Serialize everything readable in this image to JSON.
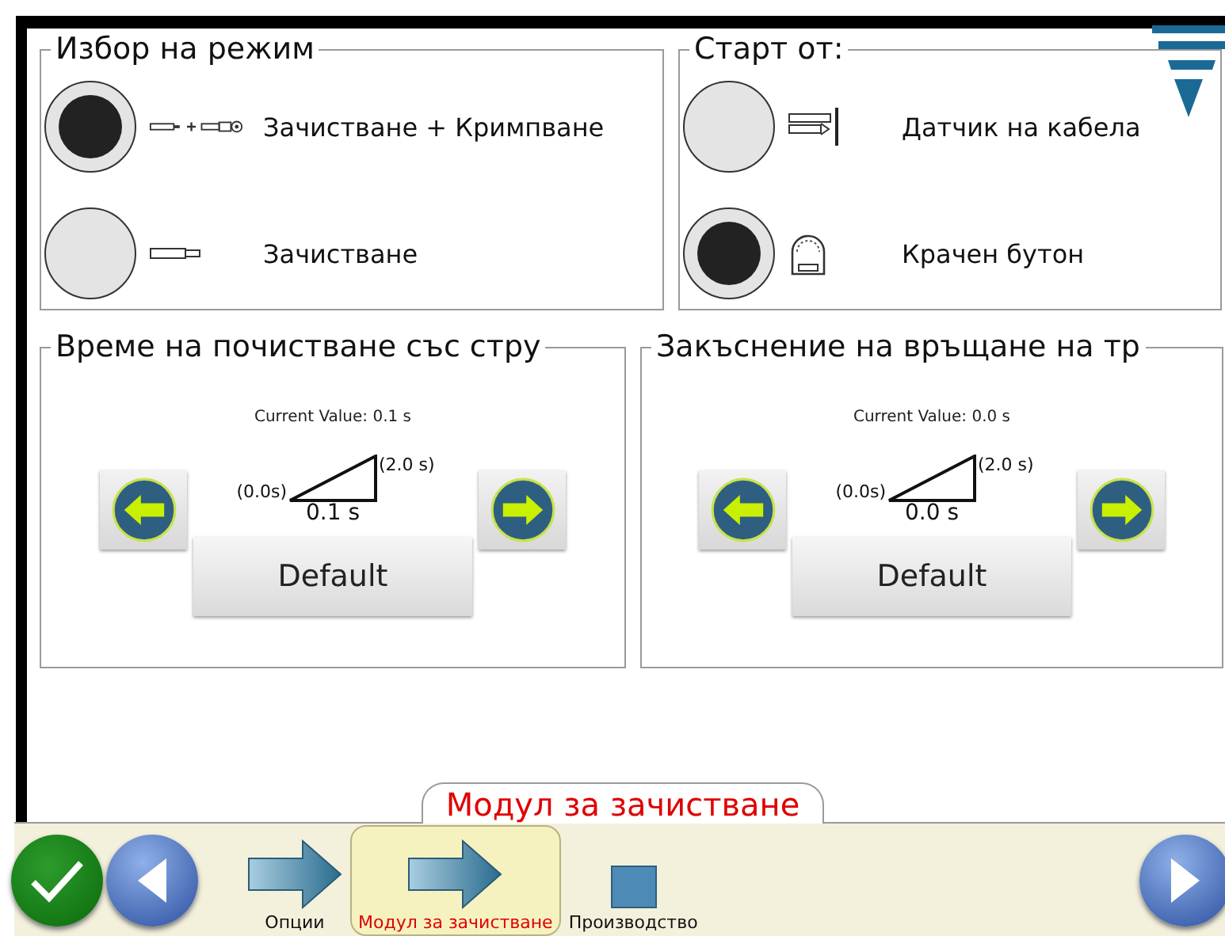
{
  "mode_group": {
    "title": "Избор на режим",
    "options": [
      {
        "kind": "strip-crimp",
        "label": "Зачистване + Кримпване",
        "selected": true
      },
      {
        "kind": "strip",
        "label": "Зачистване",
        "selected": false
      }
    ]
  },
  "start_group": {
    "title": "Старт от:",
    "options": [
      {
        "kind": "cable-sensor",
        "label": "Датчик на кабела",
        "selected": false
      },
      {
        "kind": "foot-pedal",
        "label": "Крачен бутон",
        "selected": true
      }
    ]
  },
  "settings": [
    {
      "title": "Време на почистване със стру",
      "current_value": "Current Value: 0.1 s",
      "min_label": "(0.0s)",
      "max_label": "(2.0 s)",
      "value": "0.1 s",
      "default_button": "Default"
    },
    {
      "title": "Закъснение на връщане на тр",
      "current_value": "Current Value: 0.0 s",
      "min_label": "(0.0s)",
      "max_label": "(2.0 s)",
      "value": "0.0 s",
      "default_button": "Default"
    }
  ],
  "page_title": "Модул за зачистване",
  "nav": {
    "items": [
      {
        "kind": "arrow",
        "label": "Опции",
        "selected": false
      },
      {
        "kind": "arrow",
        "label": "Модул за зачистване",
        "selected": true
      },
      {
        "kind": "square",
        "label": "Производство",
        "selected": false
      }
    ]
  }
}
